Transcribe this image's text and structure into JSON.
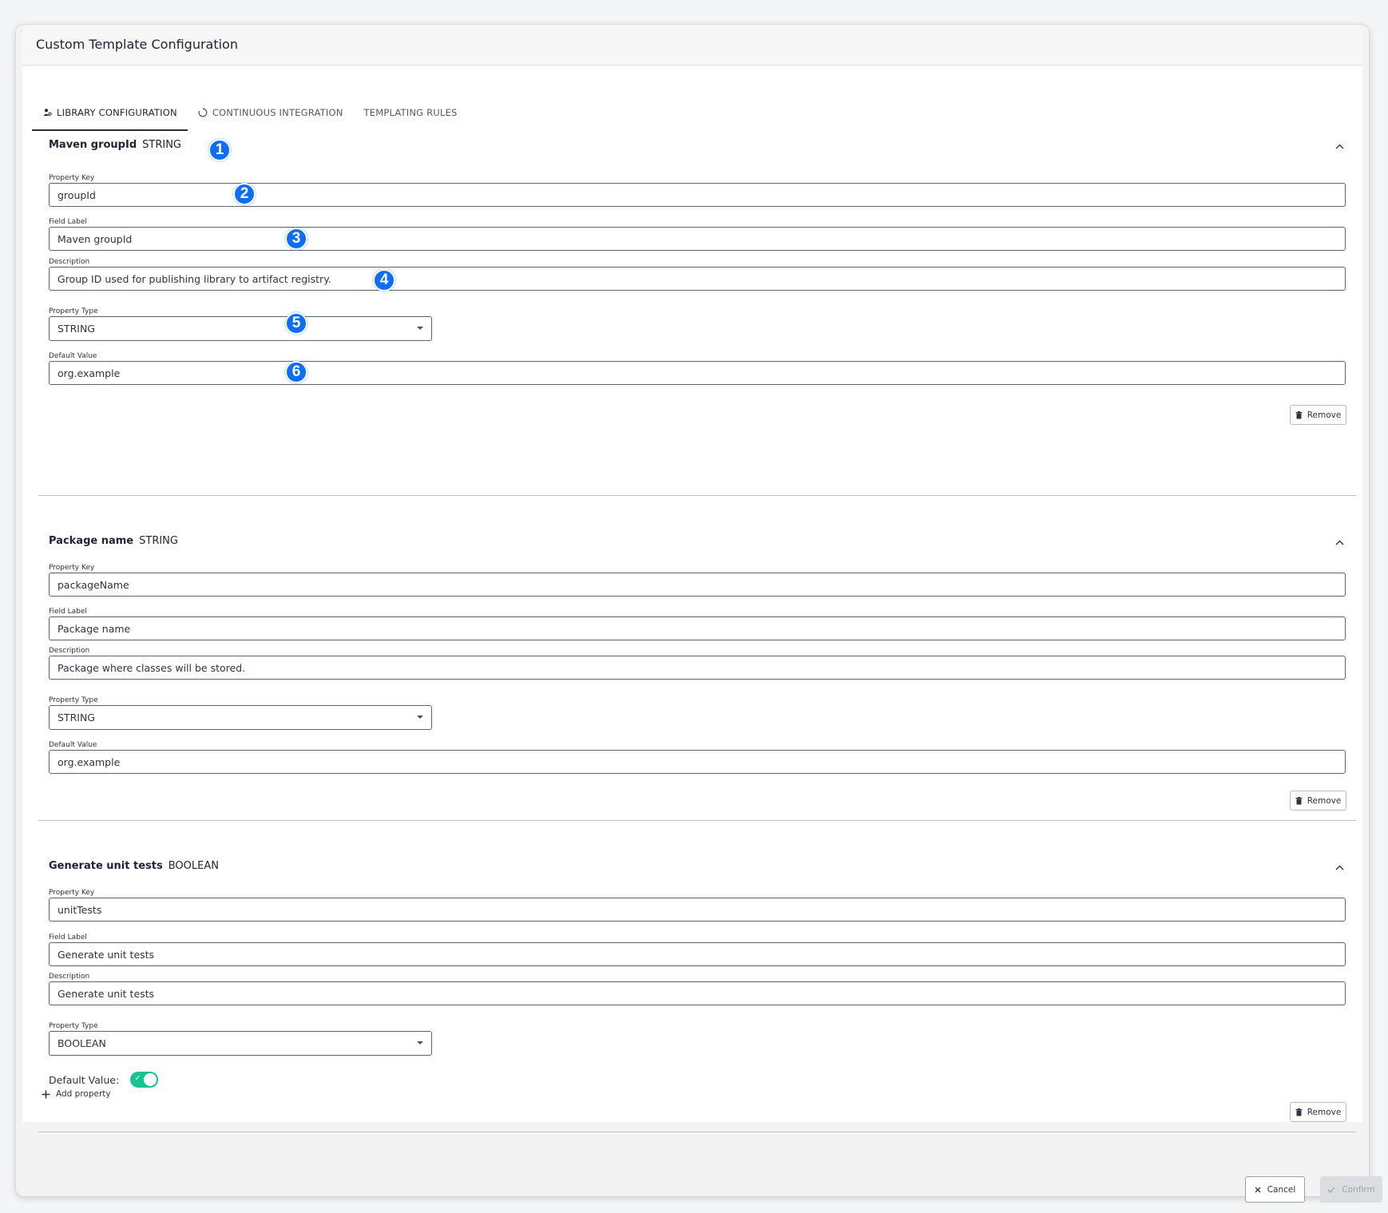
{
  "dialog": {
    "title": "Custom Template Configuration"
  },
  "tabs": [
    {
      "label": "LIBRARY CONFIGURATION",
      "icon": "library-icon",
      "active": true
    },
    {
      "label": "CONTINUOUS INTEGRATION",
      "icon": "ci-circle-icon",
      "active": false
    },
    {
      "label": "TEMPLATING RULES",
      "icon": "",
      "active": false
    }
  ],
  "labels": {
    "property_key": "Property Key",
    "field_label": "Field Label",
    "description": "Description",
    "property_type": "Property Type",
    "default_value": "Default Value",
    "default_value_toggle": "Default Value:",
    "remove": "Remove"
  },
  "properties": [
    {
      "name": "Maven groupId",
      "type": "STRING",
      "property_key": "groupId",
      "field_label": "Maven groupId",
      "description": "Group ID used for publishing library to artifact registry.",
      "property_type": "STRING",
      "default_value": "org.example"
    },
    {
      "name": "Package name",
      "type": "STRING",
      "property_key": "packageName",
      "field_label": "Package name",
      "description": "Package where classes will be stored.",
      "property_type": "STRING",
      "default_value": "org.example"
    },
    {
      "name": "Generate unit tests",
      "type": "BOOLEAN",
      "property_key": "unitTests",
      "field_label": "Generate unit tests",
      "description": "Generate unit tests",
      "property_type": "BOOLEAN",
      "default_value_toggle": true
    }
  ],
  "add_property_label": "Add property",
  "footer": {
    "cancel_label": "Cancel",
    "confirm_label": "Confirm"
  },
  "badges": [
    "1",
    "2",
    "3",
    "4",
    "5",
    "6"
  ],
  "colors": {
    "badge": "#0d6efd",
    "toggle_on": "#17c491"
  }
}
